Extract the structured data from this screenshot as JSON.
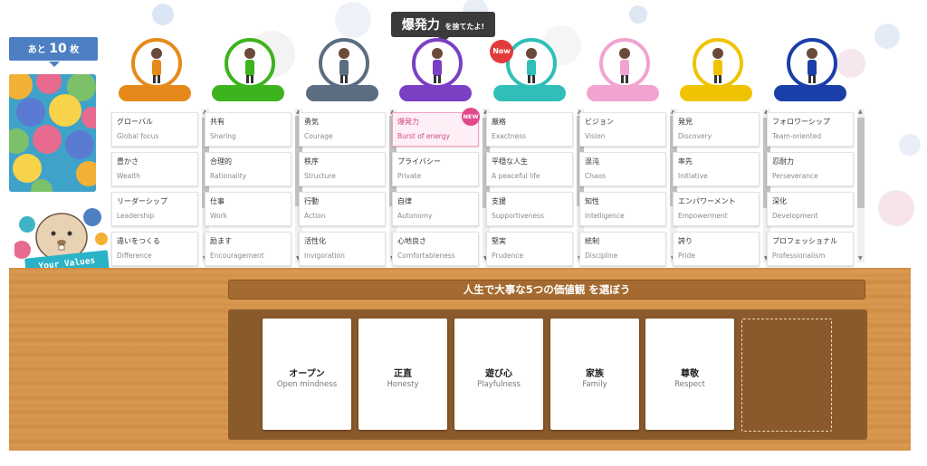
{
  "header": {
    "remaining": {
      "prefix": "あと",
      "count": "10",
      "suffix": "枚"
    },
    "toast": {
      "word": "爆発力",
      "suffix": "を捨てたよ!"
    },
    "your_values_label": "Your Values"
  },
  "columns": [
    {
      "color": "#e58a1a",
      "icon": "cat-icon",
      "badge": "",
      "cards": [
        {
          "jp": "グローバル",
          "en": "Global focus"
        },
        {
          "jp": "豊かさ",
          "en": "Wealth"
        },
        {
          "jp": "リーダーシップ",
          "en": "Leadership"
        },
        {
          "jp": "違いをつくる",
          "en": "Difference"
        }
      ]
    },
    {
      "color": "#3db31e",
      "icon": "person-icon",
      "badge": "",
      "cards": [
        {
          "jp": "共有",
          "en": "Sharing"
        },
        {
          "jp": "合理的",
          "en": "Rationality"
        },
        {
          "jp": "仕事",
          "en": "Work"
        },
        {
          "jp": "励ます",
          "en": "Encouragement"
        }
      ]
    },
    {
      "color": "#5b6d80",
      "icon": "meditation-icon",
      "badge": "",
      "cards": [
        {
          "jp": "勇気",
          "en": "Courage"
        },
        {
          "jp": "秩序",
          "en": "Structure"
        },
        {
          "jp": "行動",
          "en": "Action"
        },
        {
          "jp": "活性化",
          "en": "Invigoration"
        }
      ]
    },
    {
      "color": "#7b3fc4",
      "icon": "person-icon",
      "badge": "",
      "cards": [
        {
          "jp": "爆発力",
          "en": "Burst of energy",
          "new": "NEW",
          "selected": true
        },
        {
          "jp": "プライバシー",
          "en": "Private"
        },
        {
          "jp": "自律",
          "en": "Autonomy"
        },
        {
          "jp": "心地良さ",
          "en": "Comfortableness"
        }
      ]
    },
    {
      "color": "#2fbfb8",
      "icon": "person-icon",
      "badge": "Now",
      "cards": [
        {
          "jp": "厳格",
          "en": "Exactness"
        },
        {
          "jp": "平穏な人生",
          "en": "A peaceful life"
        },
        {
          "jp": "支援",
          "en": "Supportiveness"
        },
        {
          "jp": "堅実",
          "en": "Prudence"
        }
      ]
    },
    {
      "color": "#f2a3cf",
      "icon": "chair-person-icon",
      "badge": "",
      "cards": [
        {
          "jp": "ビジョン",
          "en": "Vision"
        },
        {
          "jp": "混沌",
          "en": "Chaos"
        },
        {
          "jp": "知性",
          "en": "Intelligence"
        },
        {
          "jp": "統制",
          "en": "Discipline"
        }
      ]
    },
    {
      "color": "#f0c300",
      "icon": "person-icon",
      "badge": "",
      "cards": [
        {
          "jp": "発見",
          "en": "Discovery"
        },
        {
          "jp": "率先",
          "en": "Initiative"
        },
        {
          "jp": "エンパワーメント",
          "en": "Empowerment"
        },
        {
          "jp": "誇り",
          "en": "Pride"
        }
      ]
    },
    {
      "color": "#1a3fa8",
      "icon": "dress-woman-icon",
      "badge": "",
      "cards": [
        {
          "jp": "フォロワーシップ",
          "en": "Team-oriented"
        },
        {
          "jp": "忍耐力",
          "en": "Perseverance"
        },
        {
          "jp": "深化",
          "en": "Development"
        },
        {
          "jp": "プロフェッショナル",
          "en": "Professionalism"
        }
      ]
    }
  ],
  "board": {
    "banner": "人生で大事な5つの価値観 を選ぼう",
    "slots": [
      {
        "jp": "オープン",
        "en": "Open mindness"
      },
      {
        "jp": "正直",
        "en": "Honesty"
      },
      {
        "jp": "遊び心",
        "en": "Playfulness"
      },
      {
        "jp": "家族",
        "en": "Family"
      },
      {
        "jp": "尊敬",
        "en": "Respect"
      },
      {
        "jp": "",
        "en": ""
      }
    ]
  }
}
